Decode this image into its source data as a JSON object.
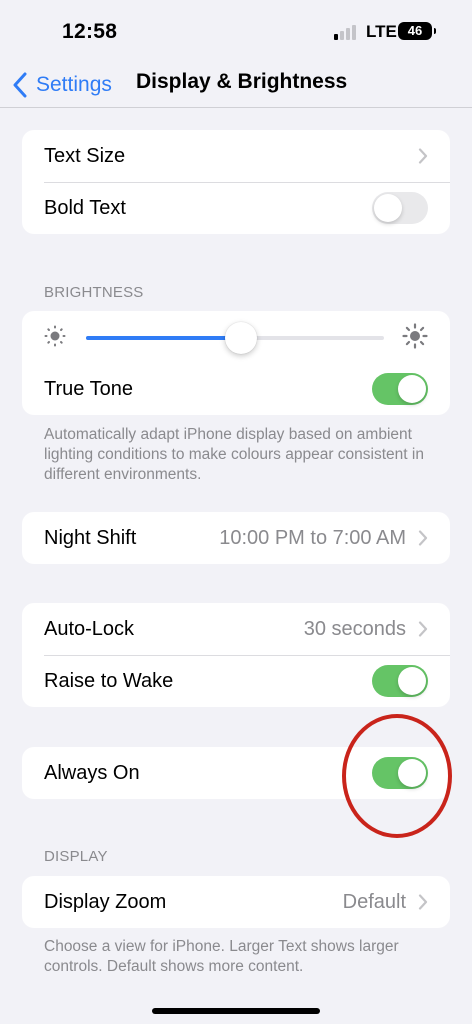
{
  "status": {
    "time": "12:58",
    "network": "LTE",
    "battery": "46"
  },
  "nav": {
    "back_label": "Settings",
    "title": "Display & Brightness"
  },
  "text_group": {
    "text_size": "Text Size",
    "bold_text": "Bold Text",
    "bold_text_on": false
  },
  "brightness": {
    "header": "BRIGHTNESS",
    "level": 0.52,
    "true_tone": "True Tone",
    "true_tone_on": true,
    "footer": "Automatically adapt iPhone display based on ambient lighting conditions to make colours appear consistent in different environments."
  },
  "night_shift": {
    "label": "Night Shift",
    "value": "10:00 PM to 7:00 AM"
  },
  "lock_group": {
    "auto_lock": "Auto-Lock",
    "auto_lock_value": "30 seconds",
    "raise_to_wake": "Raise to Wake",
    "raise_to_wake_on": true
  },
  "always_on": {
    "label": "Always On",
    "on": true
  },
  "display": {
    "header": "DISPLAY",
    "zoom_label": "Display Zoom",
    "zoom_value": "Default",
    "footer": "Choose a view for iPhone. Larger Text shows larger controls. Default shows more content."
  },
  "colors": {
    "accent": "#2f7cf6",
    "toggle_on": "#65c466",
    "annotation": "#c9241b"
  }
}
